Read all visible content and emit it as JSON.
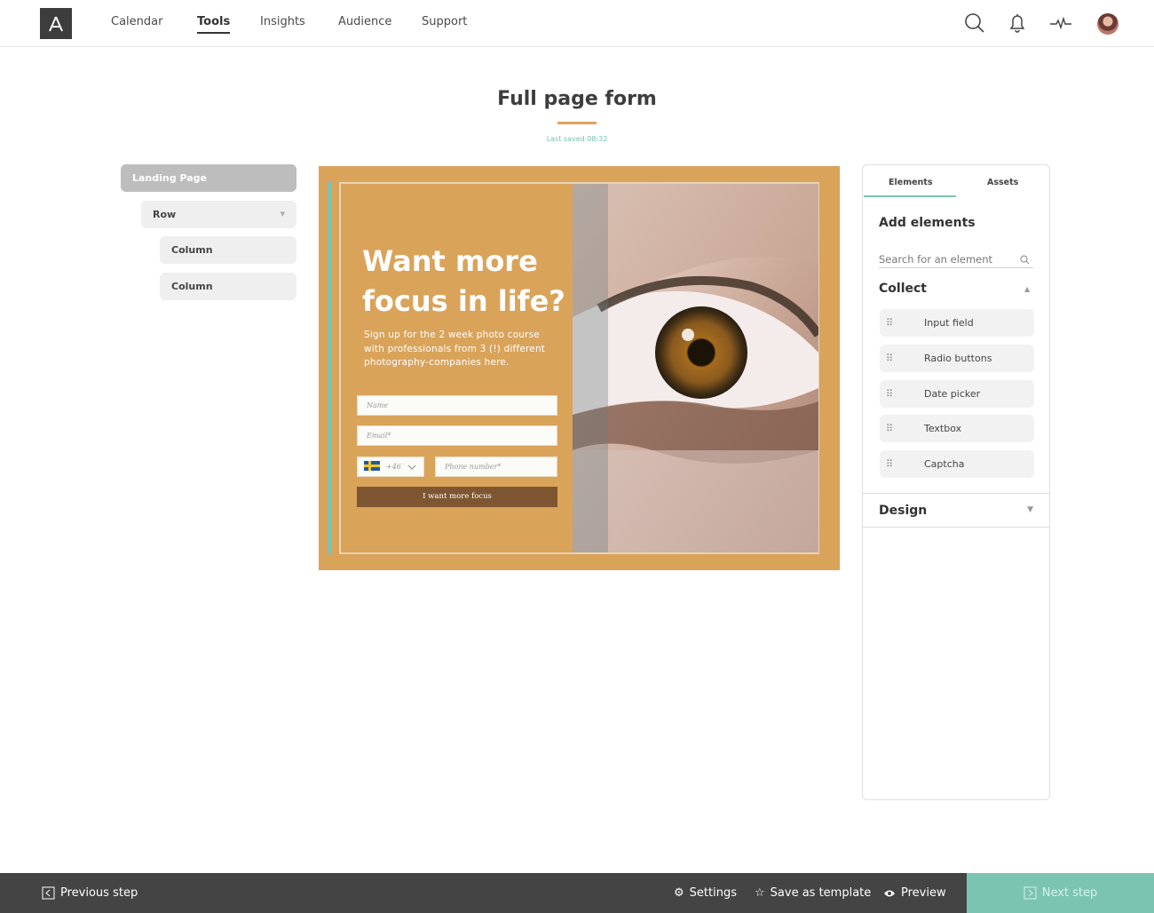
{
  "nav": {
    "items": [
      {
        "label": "Calendar"
      },
      {
        "label": "Tools",
        "active": true
      },
      {
        "label": "Insights"
      },
      {
        "label": "Audience"
      },
      {
        "label": "Support"
      }
    ]
  },
  "header": {
    "title": "Full page form",
    "last_saved": "Last saved 08:32"
  },
  "tree": {
    "items": [
      {
        "label": "Landing Page",
        "selected": true
      },
      {
        "label": "Row"
      },
      {
        "label": "Column"
      },
      {
        "label": "Column"
      }
    ]
  },
  "canvas": {
    "heading": "Want more focus in life?",
    "subtext": "Sign up for the 2 week photo course with professionals from 3 (!) different photography-companies here.",
    "name_placeholder": "Name",
    "email_placeholder": "Email*",
    "country_code": "+46",
    "phone_placeholder": "Phone number*",
    "submit_label": "I want more focus"
  },
  "panel": {
    "tabs": [
      {
        "label": "Elements",
        "active": true
      },
      {
        "label": "Assets"
      }
    ],
    "add_title": "Add elements",
    "search_placeholder": "Search for an element",
    "collect_title": "Collect",
    "elements": [
      {
        "label": "Input field"
      },
      {
        "label": "Radio buttons"
      },
      {
        "label": "Date picker"
      },
      {
        "label": "Textbox"
      },
      {
        "label": "Captcha"
      }
    ],
    "design_title": "Design"
  },
  "bottom": {
    "previous": "Previous step",
    "settings": "Settings",
    "save_template": "Save as template",
    "preview": "Preview",
    "next": "Next step"
  },
  "colors": {
    "accent": "#e2a25d",
    "teal": "#7cc4b2",
    "canvas_bg": "#d9a35a",
    "bottom_bar": "#444444"
  }
}
